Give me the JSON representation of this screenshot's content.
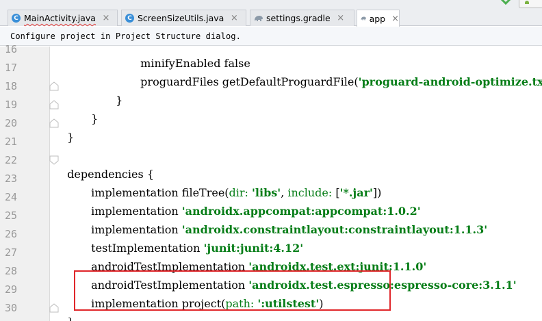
{
  "tabs": [
    {
      "label": "MainActivity.java",
      "icon": "java-class-icon",
      "icon_letter": "C",
      "has_error": true
    },
    {
      "label": "ScreenSizeUtils.java",
      "icon": "java-class-icon",
      "icon_letter": "C",
      "has_error": false
    },
    {
      "label": "settings.gradle",
      "icon": "gradle-elephant-icon",
      "icon_letter": "",
      "has_error": false
    },
    {
      "label": "app",
      "icon": "gradle-elephant-icon",
      "icon_letter": "",
      "has_error": false,
      "active": true
    }
  ],
  "tab_close_glyph": "×",
  "notice": {
    "text": "Configure project in Project Structure dialog."
  },
  "lines": [
    {
      "num": "16",
      "text": "minifyEnabled false"
    },
    {
      "num": "17",
      "text": "proguardFiles getDefaultProguardFile('proguard-android-optimize.txt"
    },
    {
      "num": "18",
      "text": "}"
    },
    {
      "num": "19",
      "text": "}"
    },
    {
      "num": "20",
      "text": "}"
    },
    {
      "num": "21",
      "text": ""
    },
    {
      "num": "22",
      "text": "dependencies {"
    },
    {
      "num": "23",
      "text": "implementation fileTree(dir: 'libs', include: ['*.jar'])"
    },
    {
      "num": "24",
      "text": "implementation 'androidx.appcompat:appcompat:1.0.2'"
    },
    {
      "num": "25",
      "text": "implementation 'androidx.constraintlayout:constraintlayout:1.1.3'"
    },
    {
      "num": "26",
      "text": "testImplementation 'junit:junit:4.12'"
    },
    {
      "num": "27",
      "text": "androidTestImplementation 'androidx.test.ext:junit:1.1.0'"
    },
    {
      "num": "28",
      "text": "androidTestImplementation 'androidx.test.espresso:espresso-core:3.1.1'"
    },
    {
      "num": "29",
      "text": "implementation project(path: ':utilstest')"
    },
    {
      "num": "30",
      "text": "}"
    }
  ],
  "colors": {
    "string": "#067d17",
    "line_number": "#999999",
    "highlight_box": "#e0262a",
    "gutter_bg": "#f0f0f0",
    "tab_bar_bg": "#eceef1",
    "class_icon": "#3a8fd8"
  }
}
